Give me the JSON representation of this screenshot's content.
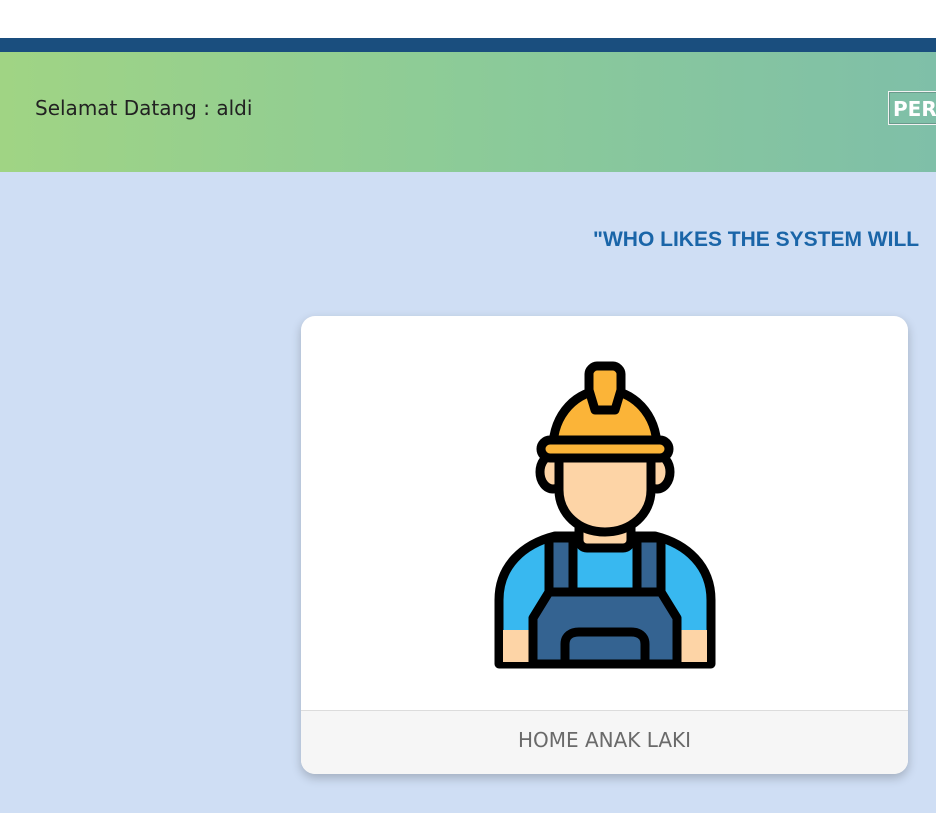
{
  "header": {
    "welcome_text": "Selamat Datang : aldi",
    "button_label": "PER"
  },
  "main": {
    "motto": "\"WHO LIKES THE SYSTEM WILL"
  },
  "card": {
    "icon": "construction-worker-icon",
    "footer_label": "HOME ANAK LAKI"
  },
  "colors": {
    "topline": "#1a4e7e",
    "header_gradient_start": "#a0d484",
    "header_gradient_end": "#7fbfa8",
    "background": "#cfdef4",
    "motto_text": "#1a65a8",
    "helmet": "#fbb438",
    "shirt": "#38b8f0",
    "overalls": "#346391",
    "skin": "#fdd4a6"
  }
}
